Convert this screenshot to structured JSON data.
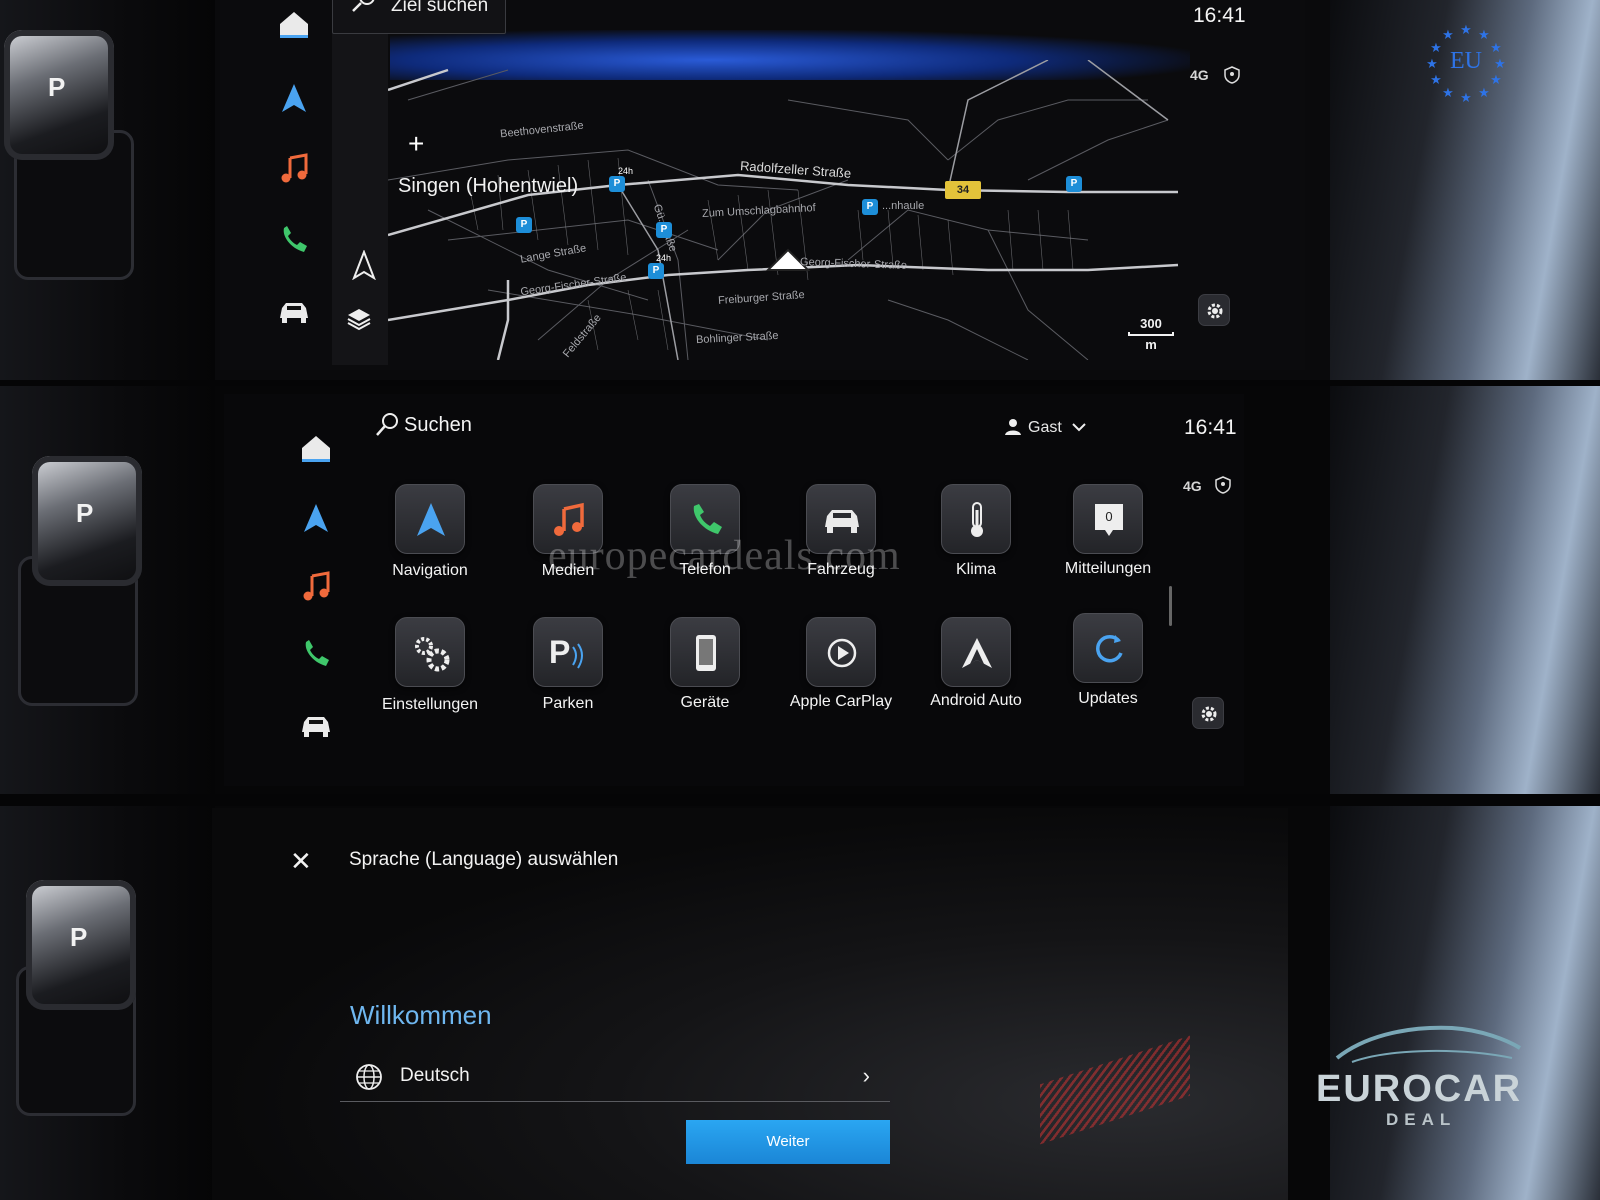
{
  "strip1": {
    "search_label": "Ziel suchen",
    "clock": "16:41",
    "network": "4G",
    "city": "Singen (Hohentwiel)",
    "streets": [
      "Beethovenstraße",
      "Radolfzeller Straße",
      "Zum Umschlagbahnhof",
      "Lange Straße",
      "Georg-Fischer-Straße",
      "Georg-Fischer-Straße",
      "Freiburger Straße",
      "Bohlinger Straße",
      "Feldstraße",
      "Gü...traße",
      "...nhaule"
    ],
    "road_number": "34",
    "parking_tag": "24h",
    "scale_value": "300",
    "scale_unit": "m"
  },
  "strip2": {
    "search_label": "Suchen",
    "user": "Gast",
    "clock": "16:41",
    "network": "4G",
    "notification_count": "0",
    "apps_row1": [
      "Navigation",
      "Medien",
      "Telefon",
      "Fahrzeug",
      "Klima",
      "Mitteilungen"
    ],
    "apps_row2": [
      "Einstellungen",
      "Parken",
      "Geräte",
      "Apple CarPlay",
      "Android Auto",
      "Updates"
    ],
    "watermark": "europecardeals.com"
  },
  "strip3": {
    "title": "Sprache (Language) auswählen",
    "welcome": "Willkommen",
    "language": "Deutsch",
    "next_label": "Weiter"
  },
  "branding": {
    "eu_label": "EU",
    "logo_line1": "EUROCAR",
    "logo_line2": "DEAL"
  },
  "colors": {
    "accent_blue": "#1b86d6",
    "welcome_blue": "#6fb7f0",
    "nav_icon": "#4aa3f0",
    "media_icon": "#f06a3c",
    "phone_icon": "#3fc76b"
  },
  "gear_position": "P"
}
